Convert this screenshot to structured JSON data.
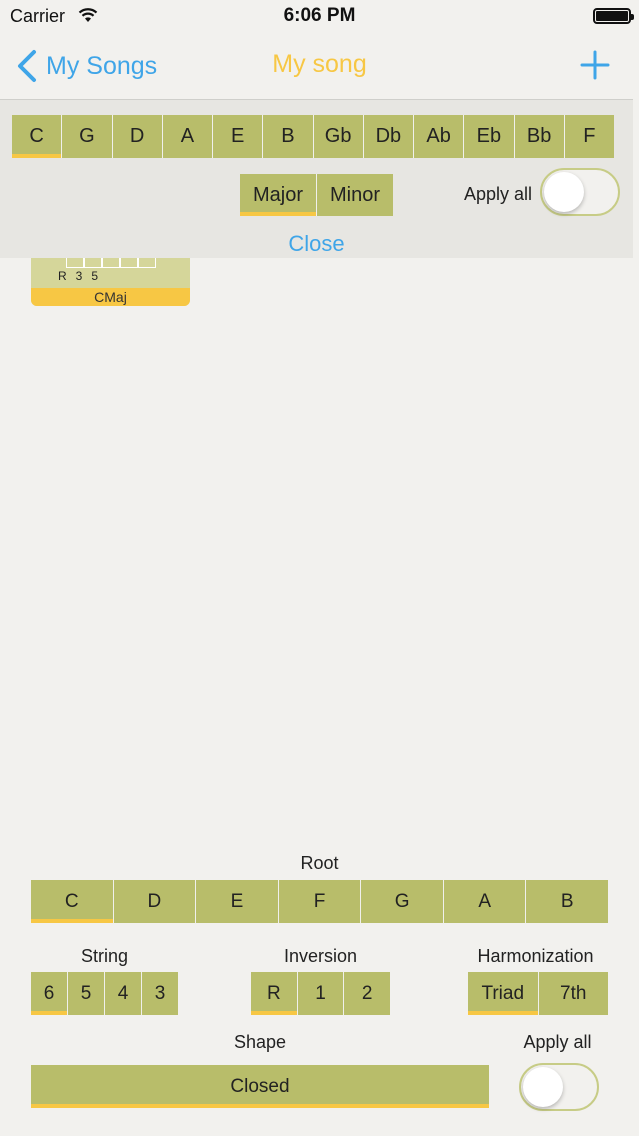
{
  "status_bar": {
    "carrier": "Carrier",
    "time": "6:06 PM"
  },
  "nav": {
    "back_label": "My Songs",
    "title": "My song",
    "add_icon": "plus-icon"
  },
  "key_picker": {
    "keys": [
      "C",
      "G",
      "D",
      "A",
      "E",
      "B",
      "Gb",
      "Db",
      "Ab",
      "Eb",
      "Bb",
      "F"
    ],
    "selected_key": "C",
    "modes": [
      "Major",
      "Minor"
    ],
    "selected_mode": "Major",
    "apply_all_label": "Apply all",
    "apply_all_on": false,
    "close_label": "Close"
  },
  "chord_card": {
    "notes": [
      "R",
      "3",
      "5"
    ],
    "name": "CMaj"
  },
  "bottom": {
    "root_label": "Root",
    "roots": [
      "C",
      "D",
      "E",
      "F",
      "G",
      "A",
      "B"
    ],
    "selected_root": "C",
    "string_label": "String",
    "strings": [
      "6",
      "5",
      "4",
      "3"
    ],
    "selected_string": "6",
    "inversion_label": "Inversion",
    "inversions": [
      "R",
      "1",
      "2"
    ],
    "selected_inversion": "R",
    "harmonization_label": "Harmonization",
    "harmonizations": [
      "Triad",
      "7th"
    ],
    "selected_harmonization": "Triad",
    "shape_label": "Shape",
    "shape_value": "Closed",
    "apply_all_label": "Apply all",
    "apply_all_on": false
  },
  "colors": {
    "accent_blue": "#3fa5e8",
    "title_yellow": "#f7c744",
    "button_olive": "#b8bd6a",
    "selection_yellow": "#f7c744",
    "background": "#f2f1ee"
  }
}
